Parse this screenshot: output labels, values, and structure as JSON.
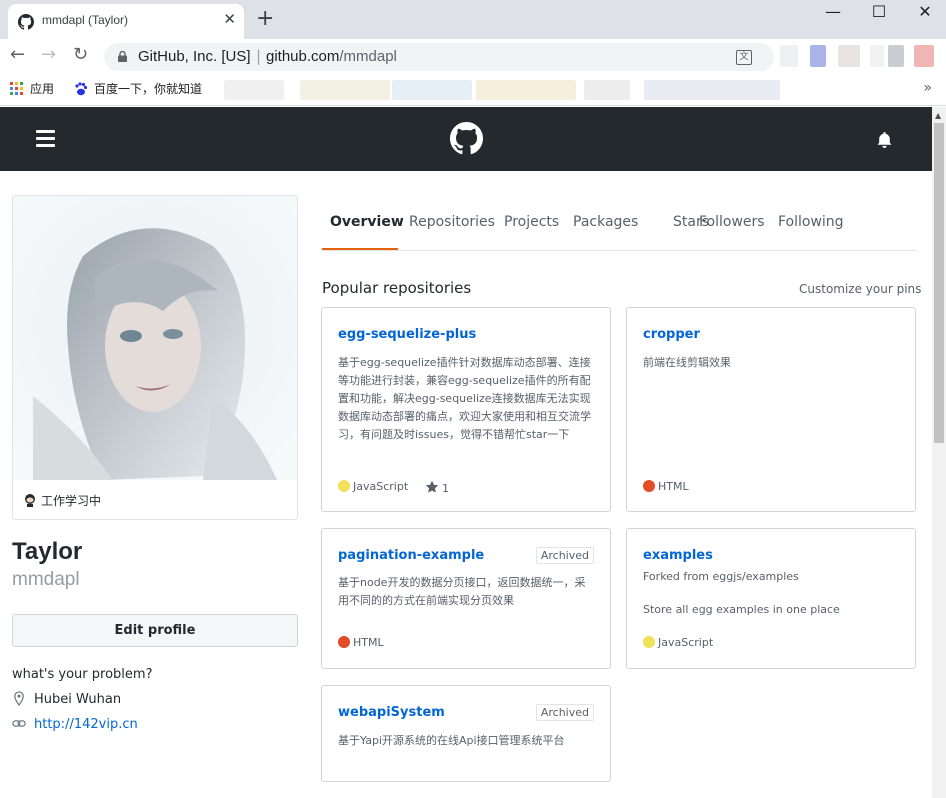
{
  "browser": {
    "tab_title": "mmdapl (Taylor)",
    "tab_close": "✕",
    "new_tab": "+",
    "cert_name": "GitHub, Inc. [US]",
    "separator": "|",
    "url_host": "github.com",
    "url_path": "/mmdapl",
    "window_controls": {
      "minimize": "—",
      "maximize": "☐",
      "close": "✕"
    },
    "bookmarks": [
      {
        "label": "应用"
      },
      {
        "label": "百度一下，你就知道"
      }
    ],
    "bookmarks_overflow": "»"
  },
  "header": {
    "icons": [
      "hamburger-icon",
      "github-logo",
      "bell-icon"
    ]
  },
  "profile": {
    "status": "工作学习中",
    "fullname": "Taylor",
    "username": "mmdapl",
    "edit_profile": "Edit profile",
    "bio": "what's your problem?",
    "location": "Hubei Wuhan",
    "website": "http://142vip.cn"
  },
  "tabs": [
    {
      "label": "Overview",
      "selected": true
    },
    {
      "label": "Repositories"
    },
    {
      "label": "Projects"
    },
    {
      "label": "Packages"
    },
    {
      "label": "Stars"
    },
    {
      "label": "Followers"
    },
    {
      "label": "Following"
    }
  ],
  "pinned": {
    "title": "Popular repositories",
    "customize": "Customize your pins",
    "repos": [
      {
        "name": "egg-sequelize-plus",
        "description": "基于egg-sequelize插件针对数据库动态部署、连接等功能进行封装，兼容egg-sequelize插件的所有配置和功能，解决egg-sequelize连接数据库无法实现数据库动态部署的痛点，欢迎大家使用和相互交流学习，有问题及时issues，觉得不错帮忙star一下",
        "language": "JavaScript",
        "language_color": "#f1e05a",
        "stars": "1"
      },
      {
        "name": "cropper",
        "description": "前端在线剪辑效果",
        "language": "HTML",
        "language_color": "#e34c26"
      },
      {
        "name": "pagination-example",
        "badge": "Archived",
        "description": "基于node开发的数据分页接口，返回数据统一，采用不同的的方式在前端实现分页效果",
        "language": "HTML",
        "language_color": "#e34c26"
      },
      {
        "name": "examples",
        "fork_note": "Forked from eggjs/examples",
        "description": "Store all egg examples in one place",
        "language": "JavaScript",
        "language_color": "#f1e05a"
      },
      {
        "name": "webapiSystem",
        "badge": "Archived",
        "description": "基于Yapi开源系统的在线Api接口管理系统平台"
      }
    ]
  }
}
